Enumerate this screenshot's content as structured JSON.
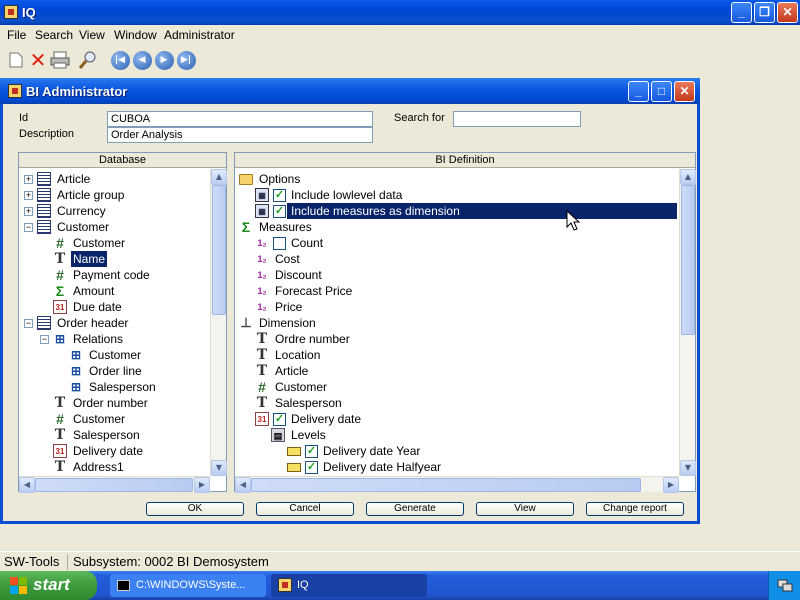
{
  "app": {
    "title": "IQ",
    "window_buttons": [
      "minimize-button",
      "restore-button",
      "close-button"
    ]
  },
  "menu": [
    "File",
    "Search",
    "View",
    "Window",
    "Administrator"
  ],
  "toolbar": [
    "new-icon",
    "delete-icon",
    "print-icon",
    "find-icon",
    "first-icon",
    "previous-icon",
    "next-icon",
    "last-icon"
  ],
  "dialog": {
    "title": "BI Administrator",
    "id_label": "Id",
    "id_value": "CUBOA",
    "desc_label": "Description",
    "desc_value": "Order Analysis",
    "search_label": "Search for",
    "search_value": "",
    "db_header": "Database",
    "bi_header": "BI Definition",
    "buttons": {
      "ok": "OK",
      "cancel": "Cancel",
      "generate": "Generate",
      "view": "View",
      "change_report": "Change report"
    }
  },
  "database_tree": [
    {
      "label": "Article",
      "icon": "table",
      "level": 0,
      "expander": "+"
    },
    {
      "label": "Article group",
      "icon": "table",
      "level": 0,
      "expander": "+"
    },
    {
      "label": "Currency",
      "icon": "table",
      "level": 0,
      "expander": "+"
    },
    {
      "label": "Customer",
      "icon": "table",
      "level": 0,
      "expander": "-"
    },
    {
      "label": "Customer",
      "icon": "hash",
      "level": 1
    },
    {
      "label": "Name",
      "icon": "text",
      "level": 1,
      "selected": true
    },
    {
      "label": "Payment code",
      "icon": "hash",
      "level": 1
    },
    {
      "label": "Amount",
      "icon": "sum",
      "level": 1
    },
    {
      "label": "Due date",
      "icon": "calendar",
      "level": 1
    },
    {
      "label": "Order header",
      "icon": "table",
      "level": 0,
      "expander": "-"
    },
    {
      "label": "Relations",
      "icon": "relation",
      "level": 1,
      "expander": "-"
    },
    {
      "label": "Customer",
      "icon": "relation",
      "level": 2
    },
    {
      "label": "Order line",
      "icon": "relation",
      "level": 2
    },
    {
      "label": "Salesperson",
      "icon": "relation",
      "level": 2
    },
    {
      "label": "Order number",
      "icon": "text",
      "level": 1
    },
    {
      "label": "Customer",
      "icon": "hash",
      "level": 1
    },
    {
      "label": "Salesperson",
      "icon": "text",
      "level": 1
    },
    {
      "label": "Delivery date",
      "icon": "calendar",
      "level": 1
    },
    {
      "label": "Address1",
      "icon": "text",
      "level": 1
    }
  ],
  "bi_tree": [
    {
      "label": "Options",
      "icon": "folder",
      "level": 0
    },
    {
      "label": "Include lowlevel data",
      "icon": "option",
      "level": 1,
      "checked": true
    },
    {
      "label": "Include measures as dimension",
      "icon": "option",
      "level": 1,
      "checked": true,
      "selected": true
    },
    {
      "label": "Measures",
      "icon": "sum",
      "level": 0
    },
    {
      "label": "Count",
      "icon": "number",
      "level": 1,
      "checked": false
    },
    {
      "label": "Cost",
      "icon": "number",
      "level": 1
    },
    {
      "label": "Discount",
      "icon": "number",
      "level": 1
    },
    {
      "label": "Forecast Price",
      "icon": "number",
      "level": 1
    },
    {
      "label": "Price",
      "icon": "number",
      "level": 1
    },
    {
      "label": "Dimension",
      "icon": "axes",
      "level": 0
    },
    {
      "label": "Ordre number",
      "icon": "text",
      "level": 1
    },
    {
      "label": "Location",
      "icon": "text",
      "level": 1
    },
    {
      "label": "Article",
      "icon": "text",
      "level": 1
    },
    {
      "label": "Customer",
      "icon": "hash",
      "level": 1
    },
    {
      "label": "Salesperson",
      "icon": "text",
      "level": 1
    },
    {
      "label": "Delivery date",
      "icon": "calendar",
      "level": 1,
      "checked": true
    },
    {
      "label": "Levels",
      "icon": "levels",
      "level": 2
    },
    {
      "label": "Delivery date Year",
      "icon": "level-item",
      "level": 3,
      "checked": true
    },
    {
      "label": "Delivery date Halfyear",
      "icon": "level-item",
      "level": 3,
      "checked": true
    }
  ],
  "status": {
    "left": "SW-Tools",
    "right": "Subsystem: 0002 BI Demosystem"
  },
  "taskbar": {
    "start": "start",
    "tasks": [
      {
        "label": "C:\\WINDOWS\\Syste...",
        "icon": "cmd-icon"
      },
      {
        "label": "IQ",
        "icon": "iq-app-icon"
      }
    ]
  }
}
